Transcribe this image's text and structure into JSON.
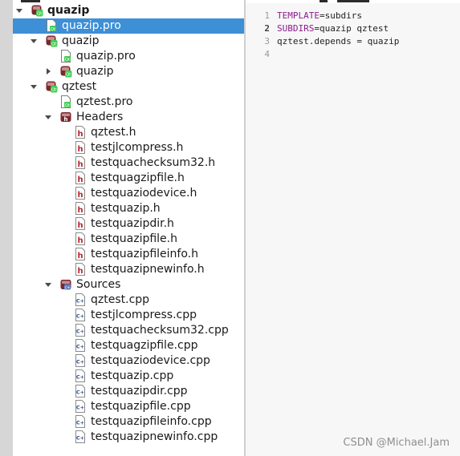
{
  "tree": {
    "rows": [
      {
        "label": "quazip",
        "indent": 0,
        "icon": "project-icon",
        "arrow": "down",
        "bold": true,
        "selected": false
      },
      {
        "label": "quazip.pro",
        "indent": 1,
        "icon": "pro-file-icon",
        "arrow": "",
        "bold": false,
        "selected": true
      },
      {
        "label": "quazip",
        "indent": 1,
        "icon": "project-icon",
        "arrow": "down",
        "bold": false,
        "selected": false
      },
      {
        "label": "quazip.pro",
        "indent": 2,
        "icon": "pro-file-icon",
        "arrow": "",
        "bold": false,
        "selected": false
      },
      {
        "label": "quazip",
        "indent": 2,
        "icon": "project-icon",
        "arrow": "right",
        "bold": false,
        "selected": false
      },
      {
        "label": "qztest",
        "indent": 1,
        "icon": "project-icon",
        "arrow": "down",
        "bold": false,
        "selected": false
      },
      {
        "label": "qztest.pro",
        "indent": 2,
        "icon": "pro-file-icon",
        "arrow": "",
        "bold": false,
        "selected": false
      },
      {
        "label": "Headers",
        "indent": 2,
        "icon": "headers-folder-icon",
        "arrow": "down",
        "bold": false,
        "selected": false
      },
      {
        "label": "qztest.h",
        "indent": 3,
        "icon": "header-file-icon",
        "arrow": "",
        "bold": false,
        "selected": false
      },
      {
        "label": "testjlcompress.h",
        "indent": 3,
        "icon": "header-file-icon",
        "arrow": "",
        "bold": false,
        "selected": false
      },
      {
        "label": "testquachecksum32.h",
        "indent": 3,
        "icon": "header-file-icon",
        "arrow": "",
        "bold": false,
        "selected": false
      },
      {
        "label": "testquagzipfile.h",
        "indent": 3,
        "icon": "header-file-icon",
        "arrow": "",
        "bold": false,
        "selected": false
      },
      {
        "label": "testquaziodevice.h",
        "indent": 3,
        "icon": "header-file-icon",
        "arrow": "",
        "bold": false,
        "selected": false
      },
      {
        "label": "testquazip.h",
        "indent": 3,
        "icon": "header-file-icon",
        "arrow": "",
        "bold": false,
        "selected": false
      },
      {
        "label": "testquazipdir.h",
        "indent": 3,
        "icon": "header-file-icon",
        "arrow": "",
        "bold": false,
        "selected": false
      },
      {
        "label": "testquazipfile.h",
        "indent": 3,
        "icon": "header-file-icon",
        "arrow": "",
        "bold": false,
        "selected": false
      },
      {
        "label": "testquazipfileinfo.h",
        "indent": 3,
        "icon": "header-file-icon",
        "arrow": "",
        "bold": false,
        "selected": false
      },
      {
        "label": "testquazipnewinfo.h",
        "indent": 3,
        "icon": "header-file-icon",
        "arrow": "",
        "bold": false,
        "selected": false
      },
      {
        "label": "Sources",
        "indent": 2,
        "icon": "sources-folder-icon",
        "arrow": "down",
        "bold": false,
        "selected": false
      },
      {
        "label": "qztest.cpp",
        "indent": 3,
        "icon": "cpp-file-icon",
        "arrow": "",
        "bold": false,
        "selected": false
      },
      {
        "label": "testjlcompress.cpp",
        "indent": 3,
        "icon": "cpp-file-icon",
        "arrow": "",
        "bold": false,
        "selected": false
      },
      {
        "label": "testquachecksum32.cpp",
        "indent": 3,
        "icon": "cpp-file-icon",
        "arrow": "",
        "bold": false,
        "selected": false
      },
      {
        "label": "testquagzipfile.cpp",
        "indent": 3,
        "icon": "cpp-file-icon",
        "arrow": "",
        "bold": false,
        "selected": false
      },
      {
        "label": "testquaziodevice.cpp",
        "indent": 3,
        "icon": "cpp-file-icon",
        "arrow": "",
        "bold": false,
        "selected": false
      },
      {
        "label": "testquazip.cpp",
        "indent": 3,
        "icon": "cpp-file-icon",
        "arrow": "",
        "bold": false,
        "selected": false
      },
      {
        "label": "testquazipdir.cpp",
        "indent": 3,
        "icon": "cpp-file-icon",
        "arrow": "",
        "bold": false,
        "selected": false
      },
      {
        "label": "testquazipfile.cpp",
        "indent": 3,
        "icon": "cpp-file-icon",
        "arrow": "",
        "bold": false,
        "selected": false
      },
      {
        "label": "testquazipfileinfo.cpp",
        "indent": 3,
        "icon": "cpp-file-icon",
        "arrow": "",
        "bold": false,
        "selected": false
      },
      {
        "label": "testquazipnewinfo.cpp",
        "indent": 3,
        "icon": "cpp-file-icon",
        "arrow": "",
        "bold": false,
        "selected": false
      }
    ]
  },
  "editor": {
    "lines": [
      {
        "number": "1",
        "key": "TEMPLATE",
        "rest": "=subdirs",
        "current": false
      },
      {
        "number": "2",
        "key": "SUBDIRS",
        "rest": "=quazip qztest",
        "current": true
      },
      {
        "number": "3",
        "key": "",
        "rest": "qztest.depends = quazip",
        "current": false
      },
      {
        "number": "4",
        "key": "",
        "rest": "",
        "current": false
      }
    ]
  },
  "watermark": "CSDN @Michael.Jam",
  "colors": {
    "selection": "#3d8fd6",
    "keyword": "#8b1c8b",
    "header_icon": "#b5282f",
    "project_icon": "#7a2a2e"
  }
}
